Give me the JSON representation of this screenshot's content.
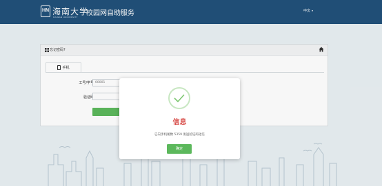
{
  "header": {
    "logo_mark": "HN",
    "university_name": "海南大学",
    "university_name_en": "HAINAN UNIVERSITY",
    "site_title": "校园网自助服务",
    "language": "中文"
  },
  "panel": {
    "title": "忘记密码?",
    "tab_label": "手机",
    "user_label": "工号/学号",
    "user_value": "00001",
    "code_label": "验证码",
    "code_value": ""
  },
  "modal": {
    "title": "信息",
    "message": "已向手机尾数 5359 发送验证码短信",
    "ok_label": "确定"
  },
  "colors": {
    "header_bg": "#22517a",
    "accent_green": "#5cb85c",
    "title_red": "#d9534f"
  },
  "icons": [
    "grid-icon",
    "home-icon",
    "phone-icon",
    "check-icon",
    "chevron-down-icon"
  ]
}
